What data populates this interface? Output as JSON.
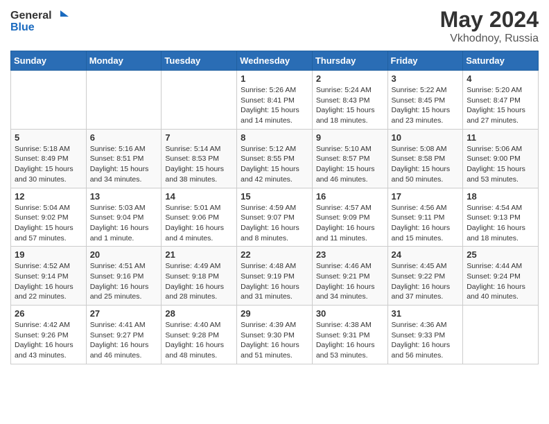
{
  "header": {
    "logo_general": "General",
    "logo_blue": "Blue",
    "title": "May 2024",
    "location": "Vkhodnoy, Russia"
  },
  "days_of_week": [
    "Sunday",
    "Monday",
    "Tuesday",
    "Wednesday",
    "Thursday",
    "Friday",
    "Saturday"
  ],
  "weeks": [
    [
      {
        "day": "",
        "info": ""
      },
      {
        "day": "",
        "info": ""
      },
      {
        "day": "",
        "info": ""
      },
      {
        "day": "1",
        "info": "Sunrise: 5:26 AM\nSunset: 8:41 PM\nDaylight: 15 hours and 14 minutes."
      },
      {
        "day": "2",
        "info": "Sunrise: 5:24 AM\nSunset: 8:43 PM\nDaylight: 15 hours and 18 minutes."
      },
      {
        "day": "3",
        "info": "Sunrise: 5:22 AM\nSunset: 8:45 PM\nDaylight: 15 hours and 23 minutes."
      },
      {
        "day": "4",
        "info": "Sunrise: 5:20 AM\nSunset: 8:47 PM\nDaylight: 15 hours and 27 minutes."
      }
    ],
    [
      {
        "day": "5",
        "info": "Sunrise: 5:18 AM\nSunset: 8:49 PM\nDaylight: 15 hours and 30 minutes."
      },
      {
        "day": "6",
        "info": "Sunrise: 5:16 AM\nSunset: 8:51 PM\nDaylight: 15 hours and 34 minutes."
      },
      {
        "day": "7",
        "info": "Sunrise: 5:14 AM\nSunset: 8:53 PM\nDaylight: 15 hours and 38 minutes."
      },
      {
        "day": "8",
        "info": "Sunrise: 5:12 AM\nSunset: 8:55 PM\nDaylight: 15 hours and 42 minutes."
      },
      {
        "day": "9",
        "info": "Sunrise: 5:10 AM\nSunset: 8:57 PM\nDaylight: 15 hours and 46 minutes."
      },
      {
        "day": "10",
        "info": "Sunrise: 5:08 AM\nSunset: 8:58 PM\nDaylight: 15 hours and 50 minutes."
      },
      {
        "day": "11",
        "info": "Sunrise: 5:06 AM\nSunset: 9:00 PM\nDaylight: 15 hours and 53 minutes."
      }
    ],
    [
      {
        "day": "12",
        "info": "Sunrise: 5:04 AM\nSunset: 9:02 PM\nDaylight: 15 hours and 57 minutes."
      },
      {
        "day": "13",
        "info": "Sunrise: 5:03 AM\nSunset: 9:04 PM\nDaylight: 16 hours and 1 minute."
      },
      {
        "day": "14",
        "info": "Sunrise: 5:01 AM\nSunset: 9:06 PM\nDaylight: 16 hours and 4 minutes."
      },
      {
        "day": "15",
        "info": "Sunrise: 4:59 AM\nSunset: 9:07 PM\nDaylight: 16 hours and 8 minutes."
      },
      {
        "day": "16",
        "info": "Sunrise: 4:57 AM\nSunset: 9:09 PM\nDaylight: 16 hours and 11 minutes."
      },
      {
        "day": "17",
        "info": "Sunrise: 4:56 AM\nSunset: 9:11 PM\nDaylight: 16 hours and 15 minutes."
      },
      {
        "day": "18",
        "info": "Sunrise: 4:54 AM\nSunset: 9:13 PM\nDaylight: 16 hours and 18 minutes."
      }
    ],
    [
      {
        "day": "19",
        "info": "Sunrise: 4:52 AM\nSunset: 9:14 PM\nDaylight: 16 hours and 22 minutes."
      },
      {
        "day": "20",
        "info": "Sunrise: 4:51 AM\nSunset: 9:16 PM\nDaylight: 16 hours and 25 minutes."
      },
      {
        "day": "21",
        "info": "Sunrise: 4:49 AM\nSunset: 9:18 PM\nDaylight: 16 hours and 28 minutes."
      },
      {
        "day": "22",
        "info": "Sunrise: 4:48 AM\nSunset: 9:19 PM\nDaylight: 16 hours and 31 minutes."
      },
      {
        "day": "23",
        "info": "Sunrise: 4:46 AM\nSunset: 9:21 PM\nDaylight: 16 hours and 34 minutes."
      },
      {
        "day": "24",
        "info": "Sunrise: 4:45 AM\nSunset: 9:22 PM\nDaylight: 16 hours and 37 minutes."
      },
      {
        "day": "25",
        "info": "Sunrise: 4:44 AM\nSunset: 9:24 PM\nDaylight: 16 hours and 40 minutes."
      }
    ],
    [
      {
        "day": "26",
        "info": "Sunrise: 4:42 AM\nSunset: 9:26 PM\nDaylight: 16 hours and 43 minutes."
      },
      {
        "day": "27",
        "info": "Sunrise: 4:41 AM\nSunset: 9:27 PM\nDaylight: 16 hours and 46 minutes."
      },
      {
        "day": "28",
        "info": "Sunrise: 4:40 AM\nSunset: 9:28 PM\nDaylight: 16 hours and 48 minutes."
      },
      {
        "day": "29",
        "info": "Sunrise: 4:39 AM\nSunset: 9:30 PM\nDaylight: 16 hours and 51 minutes."
      },
      {
        "day": "30",
        "info": "Sunrise: 4:38 AM\nSunset: 9:31 PM\nDaylight: 16 hours and 53 minutes."
      },
      {
        "day": "31",
        "info": "Sunrise: 4:36 AM\nSunset: 9:33 PM\nDaylight: 16 hours and 56 minutes."
      },
      {
        "day": "",
        "info": ""
      }
    ]
  ]
}
